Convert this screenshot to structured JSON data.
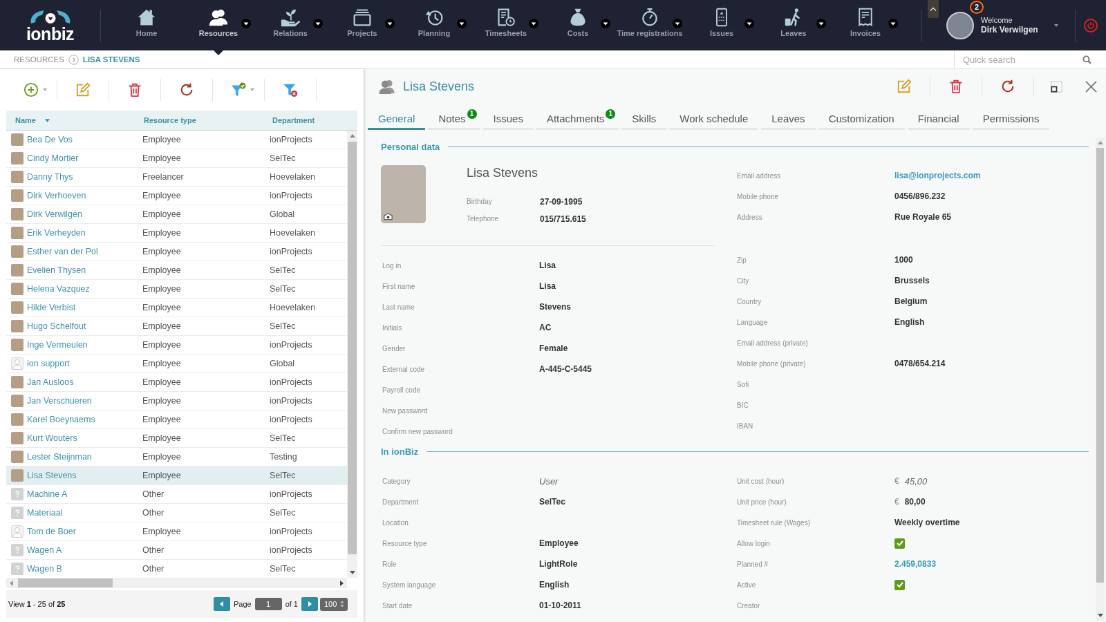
{
  "nav": {
    "brand": "ionbiz",
    "items": [
      {
        "label": "Home",
        "selected": false,
        "dropdown": false
      },
      {
        "label": "Resources",
        "selected": true,
        "dropdown": true
      },
      {
        "label": "Relations",
        "selected": false,
        "dropdown": true
      },
      {
        "label": "Projects",
        "selected": false,
        "dropdown": true
      },
      {
        "label": "Planning",
        "selected": false,
        "dropdown": true
      },
      {
        "label": "Timesheets",
        "selected": false,
        "dropdown": true
      },
      {
        "label": "Costs",
        "selected": false,
        "dropdown": true
      },
      {
        "label": "Time registrations",
        "selected": false,
        "dropdown": true
      },
      {
        "label": "Issues",
        "selected": false,
        "dropdown": true
      },
      {
        "label": "Leaves",
        "selected": false,
        "dropdown": true
      },
      {
        "label": "Invoices",
        "selected": false,
        "dropdown": true
      }
    ]
  },
  "user": {
    "greeting": "Welcome",
    "name": "Dirk Verwilgen",
    "notifications": "2"
  },
  "breadcrumb": [
    {
      "label": "RESOURCES",
      "current": false
    },
    {
      "label": "LISA STEVENS",
      "current": true
    }
  ],
  "quick_search": {
    "placeholder": "Quick search"
  },
  "resource_list": {
    "columns": [
      {
        "label": "Name",
        "sorted": true
      },
      {
        "label": "Resource type",
        "sorted": false
      },
      {
        "label": "Department",
        "sorted": false
      }
    ],
    "rows": [
      {
        "kind": "photo",
        "name": "Bea De Vos",
        "resource_type": "Employee",
        "department": "ionProjects",
        "selected": false
      },
      {
        "kind": "photo",
        "name": "Cindy Mortier",
        "resource_type": "Employee",
        "department": "SelTec",
        "selected": false
      },
      {
        "kind": "photo",
        "name": "Danny Thys",
        "resource_type": "Freelancer",
        "department": "Hoevelaken",
        "selected": false
      },
      {
        "kind": "photo",
        "name": "Dirk Verhoeven",
        "resource_type": "Employee",
        "department": "ionProjects",
        "selected": false
      },
      {
        "kind": "photo",
        "name": "Dirk Verwilgen",
        "resource_type": "Employee",
        "department": "Global",
        "selected": false
      },
      {
        "kind": "photo",
        "name": "Erik Verheyden",
        "resource_type": "Employee",
        "department": "Hoevelaken",
        "selected": false
      },
      {
        "kind": "photo",
        "name": "Esther van der Pol",
        "resource_type": "Employee",
        "department": "ionProjects",
        "selected": false
      },
      {
        "kind": "photo",
        "name": "Evelien Thysen",
        "resource_type": "Employee",
        "department": "SelTec",
        "selected": false
      },
      {
        "kind": "photo",
        "name": "Helena Vazquez",
        "resource_type": "Employee",
        "department": "SelTec",
        "selected": false
      },
      {
        "kind": "photo",
        "name": "Hilde Verbist",
        "resource_type": "Employee",
        "department": "Hoevelaken",
        "selected": false
      },
      {
        "kind": "photo",
        "name": "Hugo Schelfout",
        "resource_type": "Employee",
        "department": "SelTec",
        "selected": false
      },
      {
        "kind": "photo",
        "name": "Inge Vermeulen",
        "resource_type": "Employee",
        "department": "ionProjects",
        "selected": false
      },
      {
        "kind": "silhouette",
        "name": "ion support",
        "resource_type": "Employee",
        "department": "Global",
        "selected": false
      },
      {
        "kind": "photo",
        "name": "Jan Ausloos",
        "resource_type": "Employee",
        "department": "ionProjects",
        "selected": false
      },
      {
        "kind": "photo",
        "name": "Jan Verschueren",
        "resource_type": "Employee",
        "department": "ionProjects",
        "selected": false
      },
      {
        "kind": "photo",
        "name": "Karel Boeynaems",
        "resource_type": "Employee",
        "department": "ionProjects",
        "selected": false
      },
      {
        "kind": "photo",
        "name": "Kurt Wouters",
        "resource_type": "Employee",
        "department": "SelTec",
        "selected": false
      },
      {
        "kind": "photo",
        "name": "Lester Steijnman",
        "resource_type": "Employee",
        "department": "Testing",
        "selected": false
      },
      {
        "kind": "photo",
        "name": "Lisa Stevens",
        "resource_type": "Employee",
        "department": "SelTec",
        "selected": true
      },
      {
        "kind": "unknown",
        "name": "Machine A",
        "resource_type": "Other",
        "department": "ionProjects",
        "selected": false
      },
      {
        "kind": "unknown",
        "name": "Materiaal",
        "resource_type": "Other",
        "department": "SelTec",
        "selected": false
      },
      {
        "kind": "silhouette",
        "name": "Tom de Boer",
        "resource_type": "Employee",
        "department": "ionProjects",
        "selected": false
      },
      {
        "kind": "unknown",
        "name": "Wagen A",
        "resource_type": "Other",
        "department": "ionProjects",
        "selected": false
      },
      {
        "kind": "unknown",
        "name": "Wagen B",
        "resource_type": "Other",
        "department": "SelTec",
        "selected": false
      }
    ],
    "footer": {
      "summary": "View **1** - 25 of **25**",
      "page_label": "Page",
      "page": "1",
      "page_total": "of 1",
      "page_size": "100"
    }
  },
  "detail": {
    "title": "Lisa Stevens",
    "tabs": [
      {
        "label": "General",
        "selected": true
      },
      {
        "label": "Notes",
        "selected": false,
        "badge": "1"
      },
      {
        "label": "Issues",
        "selected": false
      },
      {
        "label": "Attachments",
        "selected": false,
        "badge": "1"
      },
      {
        "label": "Skills",
        "selected": false
      },
      {
        "label": "Work schedule",
        "selected": false
      },
      {
        "label": "Leaves",
        "selected": false
      },
      {
        "label": "Customization",
        "selected": false
      },
      {
        "label": "Financial",
        "selected": false
      },
      {
        "label": "Permissions",
        "selected": false
      }
    ]
  },
  "personal_data": {
    "heading": "Personal data",
    "name": "Lisa Stevens",
    "summary": [
      {
        "label": "Birthday",
        "value": "27-09-1995"
      },
      {
        "label": "Telephone",
        "value": "015/715.615"
      }
    ],
    "account_fields": [
      {
        "label": "Log in",
        "value": "Lisa"
      },
      {
        "label": "First name",
        "value": "Lisa"
      },
      {
        "label": "Last name",
        "value": "Stevens"
      },
      {
        "label": "Initials",
        "value": "AC"
      },
      {
        "label": "Gender",
        "value": "Female"
      },
      {
        "label": "External code",
        "value": "A-445-C-5445"
      },
      {
        "label": "Payroll code"
      },
      {
        "label": "New password"
      },
      {
        "label": "Confirm new password"
      }
    ],
    "contact_fields": [
      {
        "label": "Email address",
        "value": "lisa@ionprojects.com",
        "kind": "link"
      },
      {
        "label": "Mobile phone",
        "value": "0456/896.232",
        "kind": "text"
      },
      {
        "label": "Address",
        "value": "Rue Royale 65",
        "kind": "text"
      }
    ],
    "other_fields": [
      {
        "label": "Zip",
        "value": "1000"
      },
      {
        "label": "City",
        "value": "Brussels"
      },
      {
        "label": "Country",
        "value": "Belgium"
      },
      {
        "label": "Language",
        "value": "English"
      },
      {
        "label": "Email address (private)"
      },
      {
        "label": "Mobile phone (private)",
        "value": "0478/654.214"
      },
      {
        "label": "Sofi"
      },
      {
        "label": "BIC"
      },
      {
        "label": "IBAN"
      }
    ]
  },
  "in_ionbiz": {
    "heading": "In ionBiz",
    "left_fields": [
      {
        "label": "Category",
        "value": "User",
        "kind": "muted"
      },
      {
        "label": "Department",
        "value": "SelTec",
        "kind": "text"
      },
      {
        "label": "Location",
        "kind": "text"
      },
      {
        "label": "Resource type",
        "value": "Employee",
        "kind": "text"
      },
      {
        "label": "Role",
        "value": "LightRole",
        "kind": "text"
      },
      {
        "label": "System language",
        "value": "English",
        "kind": "text"
      },
      {
        "label": "Start date",
        "value": "01-10-2011",
        "kind": "text"
      }
    ],
    "right_fields": [
      {
        "label": "Unit cost (hour)",
        "currency": "€",
        "value": "45,00",
        "kind": "muted"
      },
      {
        "label": "Unit price (hour)",
        "currency": "€",
        "value": "80,00",
        "kind": "text"
      },
      {
        "label": "Timesheet rule (Wages)",
        "value": "Weekly overtime",
        "kind": "text"
      },
      {
        "label": "Allow login",
        "kind": "checkbox",
        "checked": true
      },
      {
        "label": "Planned #",
        "value": "2.459,0833",
        "kind": "link"
      },
      {
        "label": "Active",
        "kind": "checkbox",
        "checked": true
      },
      {
        "label": "Creator",
        "kind": "text"
      }
    ]
  }
}
